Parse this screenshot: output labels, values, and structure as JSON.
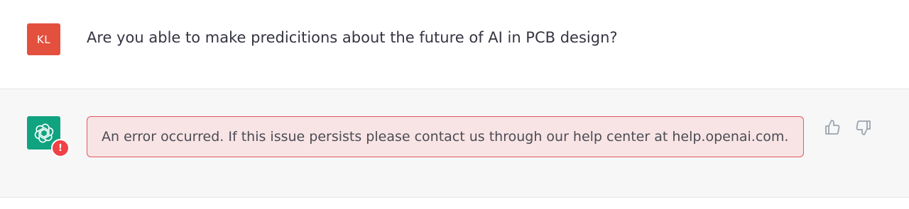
{
  "user": {
    "avatar_initials": "KL",
    "message": "Are you able to make predicitions about the future of AI in PCB design?"
  },
  "assistant": {
    "avatar_icon": "openai-logo-icon",
    "error_badge": "!",
    "error_message": "An error occurred. If this issue persists please contact us through our help center at help.openai.com."
  },
  "feedback": {
    "thumbs_up_icon": "thumbs-up-icon",
    "thumbs_down_icon": "thumbs-down-icon"
  },
  "colors": {
    "user_avatar": "#e4503e",
    "bot_avatar": "#10a37f",
    "error_border": "#e3595f",
    "error_background": "#f8e4e4",
    "error_badge": "#ef4146"
  }
}
